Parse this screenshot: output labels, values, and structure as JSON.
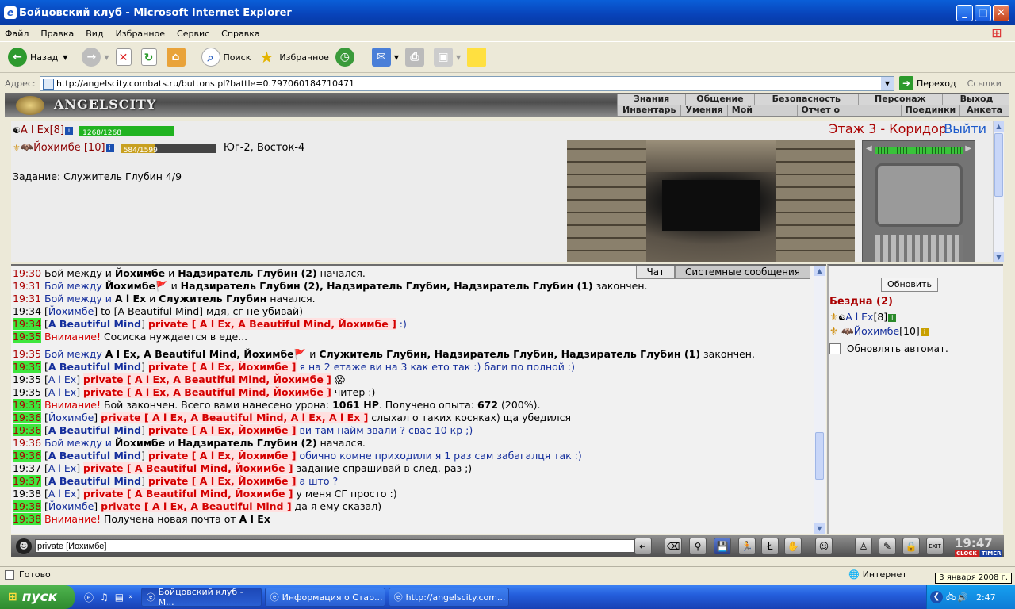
{
  "window": {
    "title": "Бойцовский клуб - Microsoft Internet Explorer"
  },
  "menu": [
    "Файл",
    "Правка",
    "Вид",
    "Избранное",
    "Сервис",
    "Справка"
  ],
  "toolbar": {
    "back": "Назад",
    "search": "Поиск",
    "favorites": "Избранное"
  },
  "address": {
    "label": "Адрес:",
    "url": "http://angelscity.combats.ru/buttons.pl?battle=0.797060184710471",
    "go": "Переход",
    "links": "Ссылки"
  },
  "game": {
    "logo": "ANGELSCITY",
    "nav_top": [
      "Знания",
      "Общение",
      "Безопасность",
      "Персонаж",
      "Выход"
    ],
    "nav_bottom": [
      "Инвентарь",
      "Умения",
      "Мой Скролл",
      "Отчет о переводах",
      "Поединки",
      "Анкета"
    ]
  },
  "player": {
    "name": "A l Ex",
    "level": "[8]",
    "hp": "1268/1268",
    "hp_fraction": 1.0
  },
  "companion": {
    "name": "Йохимбе",
    "level": "[10]",
    "hp": "584/1599",
    "hp_fraction": 0.365,
    "coords": "Юг-2, Восток-4"
  },
  "quest": "Задание: Служитель Глубин 4/9",
  "location": {
    "name": "Этаж 3 - Коридор",
    "exit": "Выйти"
  },
  "chat": {
    "tabs": [
      "Чат",
      "Системные сообщения"
    ],
    "lines": [
      {
        "t": "19:30",
        "hl": false,
        "parts": [
          [
            "n",
            "Бой между  и "
          ],
          [
            "b",
            "Йохимбе"
          ],
          [
            "n",
            " и "
          ],
          [
            "b",
            "Надзиратель Глубин (2)"
          ],
          [
            "n",
            " начался."
          ]
        ]
      },
      {
        "t": "19:31",
        "hl": false,
        "parts": [
          [
            "blue",
            "Бой между "
          ],
          [
            "b",
            "Йохимбе"
          ],
          [
            "n",
            "🚩 и "
          ],
          [
            "b",
            "Надзиратель Глубин (2), Надзиратель Глубин, Надзиратель Глубин (1)"
          ],
          [
            "n",
            " закончен."
          ]
        ]
      },
      {
        "t": "19:31",
        "hl": false,
        "parts": [
          [
            "blue",
            "Бой между  и "
          ],
          [
            "b",
            "A l Ex"
          ],
          [
            "n",
            " и "
          ],
          [
            "b",
            "Служитель Глубин"
          ],
          [
            "n",
            " начался."
          ]
        ]
      },
      {
        "t": "19:34",
        "bl": true,
        "parts": [
          [
            "n",
            "["
          ],
          [
            "blue",
            "Йохимбе"
          ],
          [
            "n",
            "] to [A Beautiful Mind] мдя, сг не убивай)"
          ]
        ]
      },
      {
        "t": "19:34",
        "hl": true,
        "parts": [
          [
            "n",
            "["
          ],
          [
            "bb",
            "A Beautiful Mind"
          ],
          [
            "n",
            "] "
          ],
          [
            "p",
            "private [ A l Ex, A Beautiful Mind, Йохимбе ]"
          ],
          [
            "blue",
            " :)"
          ]
        ]
      },
      {
        "t": "19:35",
        "hl": true,
        "parts": [
          [
            "red",
            "Внимание!"
          ],
          [
            "n",
            " Сосиска нуждается в еде..."
          ]
        ]
      },
      {
        "t": "19:35",
        "gap": true,
        "parts": [
          [
            "blue",
            "Бой между "
          ],
          [
            "b",
            "A l Ex, A Beautiful Mind, Йохимбе"
          ],
          [
            "n",
            "🚩 и "
          ],
          [
            "b",
            "Служитель Глубин, Надзиратель Глубин, Надзиратель Глубин (1)"
          ],
          [
            "n",
            " закончен."
          ]
        ]
      },
      {
        "t": "19:35",
        "hl": true,
        "parts": [
          [
            "n",
            "["
          ],
          [
            "bb",
            "A Beautiful Mind"
          ],
          [
            "n",
            "] "
          ],
          [
            "p",
            "private [ A l Ex, Йохимбе ]"
          ],
          [
            "blue",
            " я на 2 етаже ви на 3 как ето так :) баги по полной :)"
          ]
        ]
      },
      {
        "t": "19:35",
        "bl": true,
        "parts": [
          [
            "n",
            "["
          ],
          [
            "blue",
            "A l Ex"
          ],
          [
            "n",
            "] "
          ],
          [
            "p",
            "private [ A l Ex, A Beautiful Mind, Йохимбе ]"
          ],
          [
            "n",
            " 😱"
          ]
        ]
      },
      {
        "t": "19:35",
        "bl": true,
        "parts": [
          [
            "n",
            "["
          ],
          [
            "blue",
            "A l Ex"
          ],
          [
            "n",
            "] "
          ],
          [
            "p",
            "private [ A l Ex, A Beautiful Mind, Йохимбе ]"
          ],
          [
            "n",
            " читер :)"
          ]
        ]
      },
      {
        "t": "19:35",
        "hl": true,
        "parts": [
          [
            "red",
            "Внимание!"
          ],
          [
            "n",
            " Бой закончен. Всего вами нанесено урона: "
          ],
          [
            "b",
            "1061 HP"
          ],
          [
            "n",
            ". Получено опыта: "
          ],
          [
            "b",
            "672"
          ],
          [
            "n",
            " (200%)."
          ]
        ]
      },
      {
        "t": "19:36",
        "hl": true,
        "parts": [
          [
            "n",
            "["
          ],
          [
            "blue",
            "Йохимбе"
          ],
          [
            "n",
            "] "
          ],
          [
            "p",
            "private [ A l Ex, A Beautiful Mind, A l Ex, A l Ex ]"
          ],
          [
            "n",
            " слыхал о таких косяках) ща убедился"
          ]
        ]
      },
      {
        "t": "19:36",
        "hl": true,
        "parts": [
          [
            "n",
            "["
          ],
          [
            "bb",
            "A Beautiful Mind"
          ],
          [
            "n",
            "] "
          ],
          [
            "p",
            "private [ A l Ex, Йохимбе ]"
          ],
          [
            "blue",
            " ви там найм звали ? свас 10 кр ;)"
          ]
        ]
      },
      {
        "t": "19:36",
        "hl": false,
        "parts": [
          [
            "blue",
            "Бой между  и "
          ],
          [
            "b",
            "Йохимбе"
          ],
          [
            "n",
            " и "
          ],
          [
            "b",
            "Надзиратель Глубин (2)"
          ],
          [
            "n",
            " начался."
          ]
        ]
      },
      {
        "t": "19:36",
        "hl": true,
        "parts": [
          [
            "n",
            "["
          ],
          [
            "bb",
            "A Beautiful Mind"
          ],
          [
            "n",
            "] "
          ],
          [
            "p",
            "private [ A l Ex, Йохимбе ]"
          ],
          [
            "blue",
            " обично комне приходили я 1 раз сам забагалця так :)"
          ]
        ]
      },
      {
        "t": "19:37",
        "bl": true,
        "parts": [
          [
            "n",
            "["
          ],
          [
            "blue",
            "A l Ex"
          ],
          [
            "n",
            "] "
          ],
          [
            "p",
            "private [ A Beautiful Mind, Йохимбе ]"
          ],
          [
            "n",
            " задание спрашивай в след. раз ;)"
          ]
        ]
      },
      {
        "t": "19:37",
        "hl": true,
        "parts": [
          [
            "n",
            "["
          ],
          [
            "bb",
            "A Beautiful Mind"
          ],
          [
            "n",
            "] "
          ],
          [
            "p",
            "private [ A l Ex, Йохимбе ]"
          ],
          [
            "blue",
            " а што ?"
          ]
        ]
      },
      {
        "t": "19:38",
        "bl": true,
        "parts": [
          [
            "n",
            "["
          ],
          [
            "blue",
            "A l Ex"
          ],
          [
            "n",
            "] "
          ],
          [
            "p",
            "private [ A Beautiful Mind, Йохимбе ]"
          ],
          [
            "n",
            " у меня СГ просто :)"
          ]
        ]
      },
      {
        "t": "19:38",
        "hl": true,
        "parts": [
          [
            "n",
            "["
          ],
          [
            "blue",
            "Йохимбе"
          ],
          [
            "n",
            "] "
          ],
          [
            "p",
            "private [ A l Ex, A Beautiful Mind ]"
          ],
          [
            "n",
            " да я ему сказал)"
          ]
        ]
      },
      {
        "t": "19:38",
        "hl": true,
        "parts": [
          [
            "red",
            "Внимание!"
          ],
          [
            "n",
            " Получена новая почта от "
          ],
          [
            "b",
            "A l Ex"
          ]
        ]
      }
    ]
  },
  "room": {
    "refresh": "Обновить",
    "name": "Бездна (2)",
    "members": [
      {
        "name": "A l Ex",
        "level": "[8]"
      },
      {
        "name": "Йохимбе",
        "level": "[10]"
      }
    ],
    "auto": "Обновлять автомат."
  },
  "chat_input": {
    "value": "private [Йохимбе]"
  },
  "clock": {
    "time": "19:47",
    "label1": "CLOCK",
    "label2": "TIMER"
  },
  "statusbar": {
    "text": "Готово",
    "zone": "Интернет"
  },
  "tooltip": "3 января 2008 г.",
  "taskbar": {
    "start": "пуск",
    "tasks": [
      "Бойцовский клуб - М...",
      "Информация о Стар...",
      "http://angelscity.com..."
    ],
    "lang": "RU",
    "time": "2:47"
  },
  "colors": {
    "xp_blue": "#0842b8",
    "hp_green": "#21b321",
    "hp_gold": "#c8a020",
    "time_highlight": "#3de63d",
    "location_red": "#aa0000"
  }
}
